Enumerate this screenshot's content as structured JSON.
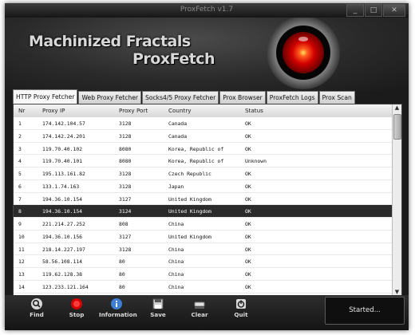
{
  "window": {
    "title": "ProxFetch v1.7",
    "minimize_label": "_",
    "maximize_label": "□",
    "close_label": "✕"
  },
  "banner": {
    "brand_line1": "Machinized Fractals",
    "brand_line2": "ProxFetch"
  },
  "tabs": [
    {
      "label": "HTTP Proxy Fetcher",
      "active": true
    },
    {
      "label": "Web Proxy Fetcher"
    },
    {
      "label": "Socks4/5 Proxy Fetcher"
    },
    {
      "label": "Prox Browser"
    },
    {
      "label": "ProxFetch Logs"
    },
    {
      "label": "Prox Scan"
    }
  ],
  "table": {
    "columns": [
      "Nr",
      "Proxy IP",
      "Proxy Port",
      "Country",
      "Status"
    ],
    "selected_index": 7,
    "rows": [
      [
        "1",
        "174.142.104.57",
        "3128",
        "Canada",
        "OK"
      ],
      [
        "2",
        "174.142.24.201",
        "3128",
        "Canada",
        "OK"
      ],
      [
        "3",
        "119.70.40.102",
        "8080",
        "Korea, Republic of",
        "OK"
      ],
      [
        "4",
        "119.70.40.101",
        "8080",
        "Korea, Republic of",
        "Unknown"
      ],
      [
        "5",
        "195.113.161.82",
        "3128",
        "Czech Republic",
        "OK"
      ],
      [
        "6",
        "133.1.74.163",
        "3128",
        "Japan",
        "OK"
      ],
      [
        "7",
        "194.36.10.154",
        "3127",
        "United Kingdom",
        "OK"
      ],
      [
        "8",
        "194.36.10.154",
        "3124",
        "United Kingdom",
        "OK"
      ],
      [
        "9",
        "221.214.27.252",
        "808",
        "China",
        "OK"
      ],
      [
        "10",
        "194.36.10.156",
        "3127",
        "United Kingdom",
        "OK"
      ],
      [
        "11",
        "218.14.227.197",
        "3128",
        "China",
        "OK"
      ],
      [
        "12",
        "58.56.108.114",
        "80",
        "China",
        "OK"
      ],
      [
        "13",
        "119.62.128.38",
        "80",
        "China",
        "OK"
      ],
      [
        "14",
        "123.233.121.164",
        "80",
        "China",
        "OK"
      ]
    ]
  },
  "toolbar": {
    "find": "Find",
    "stop": "Stop",
    "information": "Information",
    "save": "Save",
    "clear": "Clear",
    "quit": "Quit"
  },
  "status": {
    "text": "Started..."
  },
  "colors": {
    "selected_row": "#2b2b2b",
    "chrome_dark": "#1b1b1b",
    "accent_red": "#d10000"
  }
}
